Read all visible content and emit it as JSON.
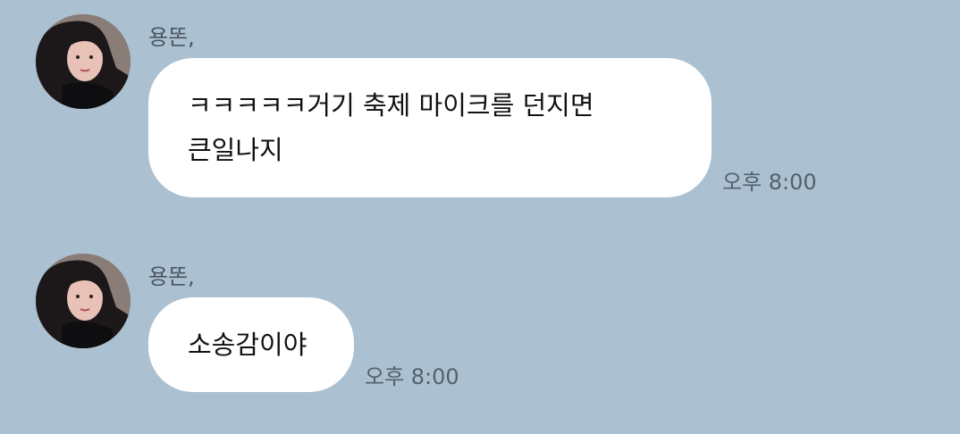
{
  "messages": [
    {
      "sender": "용똔,",
      "lines": [
        "ㅋㅋㅋㅋㅋ거기 축제 마이크를 던지면",
        "큰일나지"
      ],
      "time": "오후 8:00"
    },
    {
      "sender": "용똔,",
      "lines": [
        "소송감이야"
      ],
      "time": "오후 8:00"
    }
  ]
}
